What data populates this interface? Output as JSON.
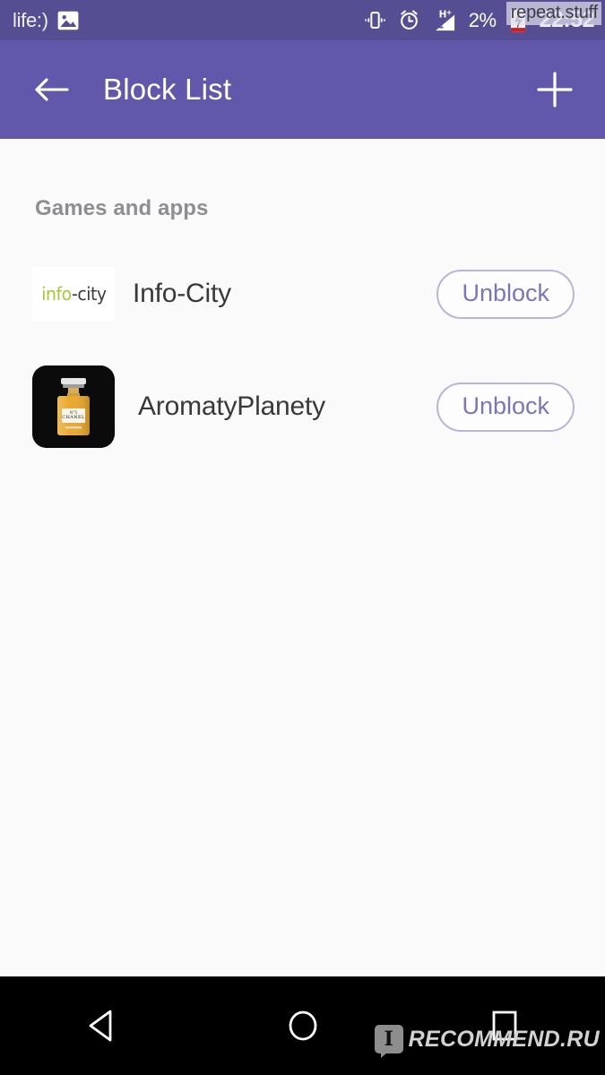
{
  "status_bar": {
    "carrier": "life:)",
    "photo_icon": "image-icon",
    "vibrate_icon": "vibrate-icon",
    "alarm_icon": "alarm-icon",
    "signal_icon": "signal-hplus-icon",
    "signal_label": "H+",
    "battery_percent": "2%",
    "battery_icon": "battery-charging-icon",
    "clock": "22:52",
    "watermark": "repeat.stuff",
    "background_color": "#554e92"
  },
  "app_bar": {
    "back_icon": "back-arrow-icon",
    "title": "Block List",
    "add_icon": "plus-icon",
    "background_color": "#6157ab"
  },
  "content": {
    "section_title": "Games and apps",
    "background_color": "#fafafb",
    "rows": [
      {
        "icon_name": "info-city-logo-icon",
        "logo_part_one": "info",
        "logo_separator": "-",
        "logo_part_two": "city",
        "logo_color_primary": "#a8c63c",
        "logo_color_secondary": "#3b3b3b",
        "name": "Info-City",
        "action_label": "Unblock"
      },
      {
        "icon_name": "aromatyplanety-perfume-icon",
        "name": "AromatyPlanety",
        "action_label": "Unblock",
        "icon_background": "#0b0b0b",
        "icon_accent": "#e9a93a"
      }
    ],
    "action_color": "#7b75b8",
    "action_border_color": "#b9b5d6"
  },
  "nav_bar": {
    "back_icon": "nav-back-triangle-icon",
    "home_icon": "nav-home-circle-icon",
    "recents_icon": "nav-recents-square-icon",
    "watermark_badge": "I",
    "watermark_text": "RECOMMEND.RU",
    "background_color": "#000000"
  }
}
